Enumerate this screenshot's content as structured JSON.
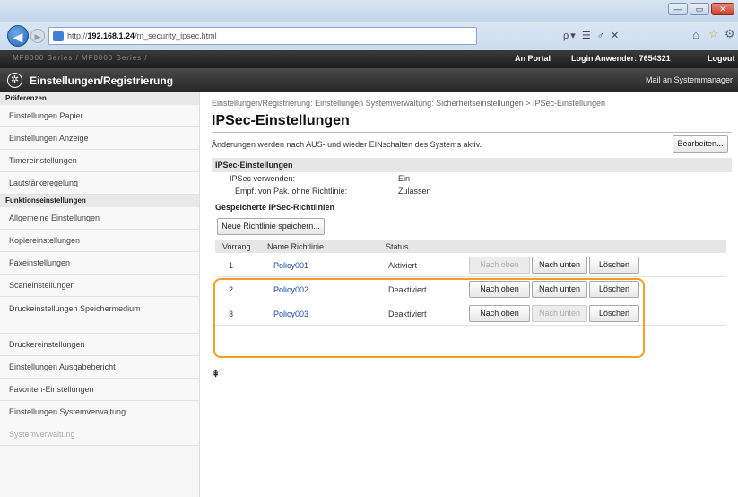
{
  "browser": {
    "url_prefix": "http://",
    "url_host": "192.168.1.24",
    "url_path": "/m_security_ipsec.html",
    "toolbar_glyphs": "ρ▾ ☰ ♂ ✕",
    "win_min": "—",
    "win_max": "▭",
    "win_close": "✕"
  },
  "device": {
    "model": "MF8000 Series / MF8000 Series /",
    "portal": "An Portal",
    "login": "Login Anwender:  7654321",
    "logout": "Logout"
  },
  "app": {
    "title": "Einstellungen/Registrierung",
    "mail": "Mail an Systemmanager"
  },
  "sidebar": {
    "sections": [
      {
        "heading": "Präferenzen",
        "items": [
          {
            "label": "Einstellungen Papier"
          },
          {
            "label": "Einstellungen Anzeige"
          },
          {
            "label": "Timereinstellungen"
          },
          {
            "label": "Lautstärkeregelung"
          }
        ]
      },
      {
        "heading": "Funktionseinstellungen",
        "items": [
          {
            "label": "Allgemeine Einstellungen"
          },
          {
            "label": "Kopiereinstellungen"
          },
          {
            "label": "Faxeinstellungen"
          },
          {
            "label": "Scaneinstellungen"
          },
          {
            "label": "Druckeinstellungen Speichermedium"
          },
          {
            "label": "Druckereinstellungen"
          },
          {
            "label": "Einstellungen Ausgabebericht"
          },
          {
            "label": "Favoriten-Einstellungen"
          }
        ]
      },
      {
        "heading": "Einstellungen Systemverwaltung",
        "items": [
          {
            "label": "Systemverwaltung"
          }
        ]
      }
    ]
  },
  "main": {
    "breadcrumb": "Einstellungen/Registrierung: Einstellungen Systemverwaltung: Sicherheitseinstellungen > IPSec-Einstellungen",
    "title": "IPSec-Einstellungen",
    "notice": "Änderungen werden nach AUS- und wieder EINschalten des Systems aktiv.",
    "edit_button": "Bearbeiten...",
    "section_title": "IPSec-Einstellungen",
    "fields": [
      {
        "key": "IPSec verwenden:",
        "value": "Ein"
      },
      {
        "key": "Empf. von Pak. ohne Richtlinie:",
        "value": "Zulassen"
      }
    ],
    "saved_policies_title": "Gespeicherte IPSec-Richtlinien",
    "save_button": "Neue Richtlinie speichern...",
    "table": {
      "headers": [
        "Vorrang",
        "Name Richtlinie",
        "Status"
      ],
      "rows": [
        {
          "priority": "1",
          "name": "Policy001",
          "status": "Aktiviert",
          "up": "Nach oben",
          "down": "Nach unten",
          "delete": "Löschen",
          "up_enabled": false,
          "down_enabled": true
        },
        {
          "priority": "2",
          "name": "Policy002",
          "status": "Deaktiviert",
          "up": "Nach oben",
          "down": "Nach unten",
          "delete": "Löschen",
          "up_enabled": true,
          "down_enabled": true
        },
        {
          "priority": "3",
          "name": "Policy003",
          "status": "Deaktiviert",
          "up": "Nach oben",
          "down": "Nach unten",
          "delete": "Löschen",
          "up_enabled": true,
          "down_enabled": false
        }
      ]
    },
    "top_link": "⇞"
  },
  "colors": {
    "highlight": "#f0a020",
    "link": "#1a4aa8"
  }
}
